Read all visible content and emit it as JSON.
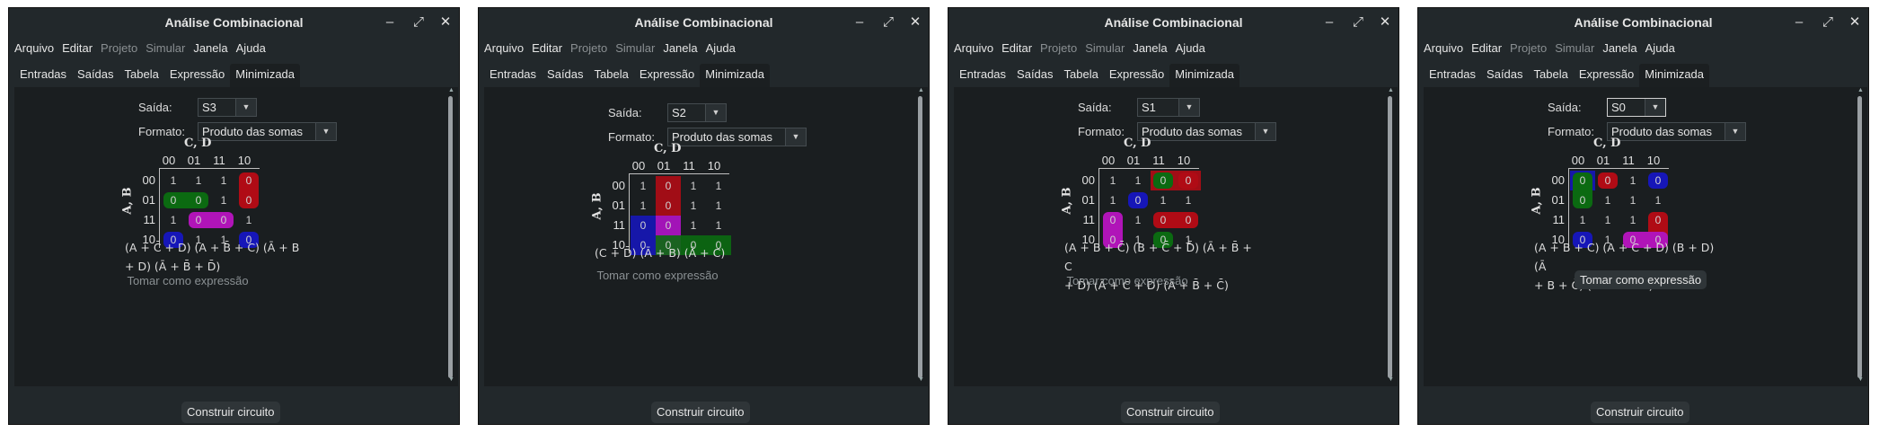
{
  "colors": {
    "red": "#b00b15",
    "green": "#0b6a11",
    "blue": "#1616b8",
    "magenta": "#b014b8"
  },
  "app": {
    "title": "Análise Combinacional",
    "menu": [
      "Arquivo",
      "Editar",
      "Projeto",
      "Simular",
      "Janela",
      "Ajuda"
    ],
    "tabs": [
      "Entradas",
      "Saídas",
      "Tabela",
      "Expressão",
      "Minimizada"
    ],
    "output_label": "Saída:",
    "format_label": "Formato:",
    "format_value": "Produto das somas",
    "row_vars": "A, B",
    "col_vars": "C, D",
    "codes": [
      "00",
      "01",
      "11",
      "10"
    ],
    "take_label": "Tomar como expressão",
    "build_label": "Construir circuito"
  },
  "windows": [
    {
      "output": "S3",
      "kmap": [
        [
          "1",
          "1",
          "1",
          "0"
        ],
        [
          "0",
          "0",
          "1",
          "0"
        ],
        [
          "1",
          "0",
          "0",
          "1"
        ],
        [
          "0",
          "1",
          "1",
          "0"
        ]
      ],
      "expr_line1": "(A + C̄ + D) (A + B̄ + C) (Ā + B",
      "expr_line2": "+ D) (Ā + B̄ + D̄)"
    },
    {
      "output": "S2",
      "kmap": [
        [
          "1",
          "0",
          "1",
          "1"
        ],
        [
          "1",
          "0",
          "1",
          "1"
        ],
        [
          "0",
          "0",
          "1",
          "1"
        ],
        [
          "0",
          "0",
          "0",
          "0"
        ]
      ],
      "expr_line1": "(C + D̄) (Ā + B) (Ā + C)",
      "expr_line2": ""
    },
    {
      "output": "S1",
      "kmap": [
        [
          "1",
          "1",
          "0",
          "0"
        ],
        [
          "1",
          "0",
          "1",
          "1"
        ],
        [
          "0",
          "1",
          "0",
          "0"
        ],
        [
          "0",
          "1",
          "0",
          "1"
        ]
      ],
      "expr_line1": "(A + B + C̄) (B + C̄ + D̄) (Ā + B̄ + C",
      "expr_line2": "+ D̄) (Ā + C + D) (Ā + B̄ + C̄)"
    },
    {
      "output": "S0",
      "kmap": [
        [
          "0",
          "0",
          "1",
          "0"
        ],
        [
          "0",
          "1",
          "1",
          "1"
        ],
        [
          "1",
          "1",
          "1",
          "0"
        ],
        [
          "0",
          "1",
          "0",
          "0"
        ]
      ],
      "expr_line1": "(A + B + C) (A + C + D) (B + D) (Ā",
      "expr_line2": "+ B + C̄) (Ā + C̄ + D)"
    }
  ]
}
